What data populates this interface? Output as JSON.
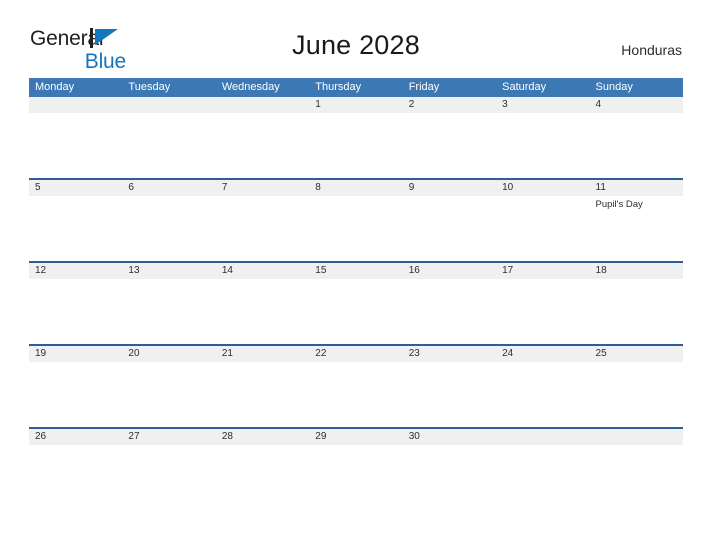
{
  "brand": {
    "name_top": "General",
    "name_bottom": "Blue",
    "flag_icon": "blue-flag-icon",
    "top_color": "#231f20",
    "bottom_color": "#1576bd"
  },
  "header": {
    "title": "June 2028",
    "country": "Honduras"
  },
  "colors": {
    "header_blue": "#3b78b4",
    "separator_blue": "#2c5f93",
    "date_strip_gray": "#f0f0f0",
    "page_background": "#ffffff"
  },
  "calendar": {
    "weekdays": [
      "Monday",
      "Tuesday",
      "Wednesday",
      "Thursday",
      "Friday",
      "Saturday",
      "Sunday"
    ],
    "weeks": [
      [
        {
          "date": "",
          "events": []
        },
        {
          "date": "",
          "events": []
        },
        {
          "date": "",
          "events": []
        },
        {
          "date": "1",
          "events": []
        },
        {
          "date": "2",
          "events": []
        },
        {
          "date": "3",
          "events": []
        },
        {
          "date": "4",
          "events": []
        }
      ],
      [
        {
          "date": "5",
          "events": []
        },
        {
          "date": "6",
          "events": []
        },
        {
          "date": "7",
          "events": []
        },
        {
          "date": "8",
          "events": []
        },
        {
          "date": "9",
          "events": []
        },
        {
          "date": "10",
          "events": []
        },
        {
          "date": "11",
          "events": [
            "Pupil's Day"
          ]
        }
      ],
      [
        {
          "date": "12",
          "events": []
        },
        {
          "date": "13",
          "events": []
        },
        {
          "date": "14",
          "events": []
        },
        {
          "date": "15",
          "events": []
        },
        {
          "date": "16",
          "events": []
        },
        {
          "date": "17",
          "events": []
        },
        {
          "date": "18",
          "events": []
        }
      ],
      [
        {
          "date": "19",
          "events": []
        },
        {
          "date": "20",
          "events": []
        },
        {
          "date": "21",
          "events": []
        },
        {
          "date": "22",
          "events": []
        },
        {
          "date": "23",
          "events": []
        },
        {
          "date": "24",
          "events": []
        },
        {
          "date": "25",
          "events": []
        }
      ],
      [
        {
          "date": "26",
          "events": []
        },
        {
          "date": "27",
          "events": []
        },
        {
          "date": "28",
          "events": []
        },
        {
          "date": "29",
          "events": []
        },
        {
          "date": "30",
          "events": []
        },
        {
          "date": "",
          "events": []
        },
        {
          "date": "",
          "events": []
        }
      ]
    ]
  }
}
